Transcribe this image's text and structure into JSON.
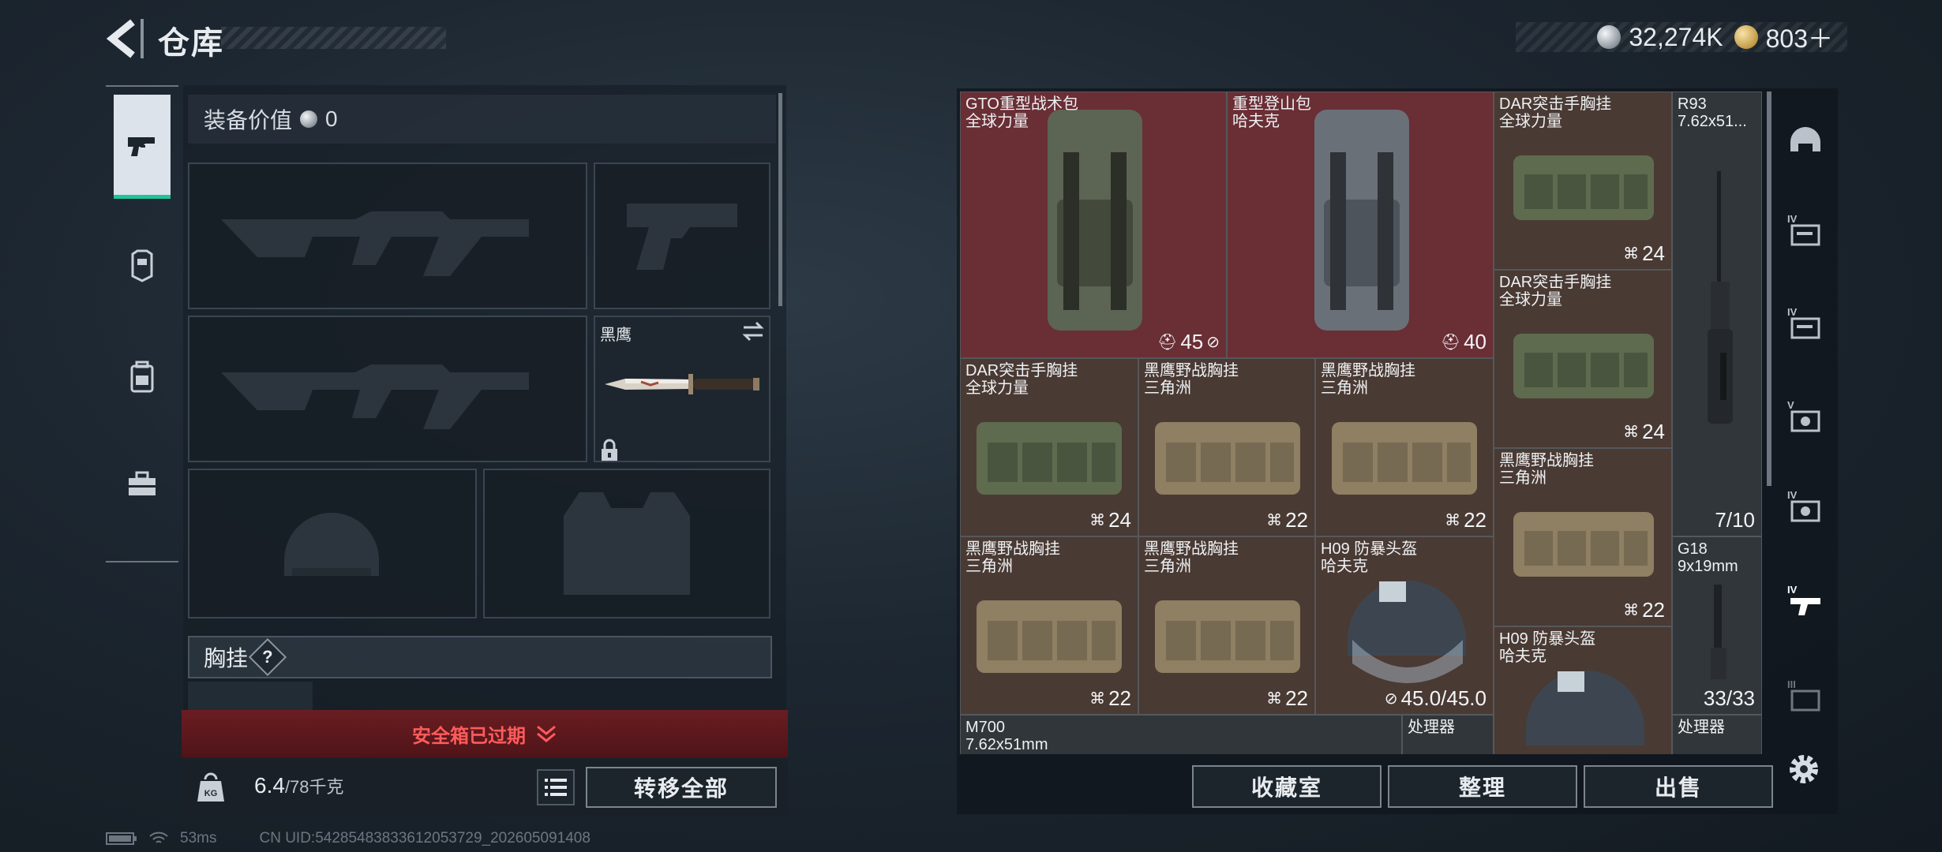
{
  "header": {
    "title": "仓库",
    "back_icon": "back-arrow-icon",
    "currency": [
      {
        "icon": "silver-coin-icon",
        "value": "32,274K"
      },
      {
        "icon": "gold-coin-icon",
        "value": "803＋"
      }
    ]
  },
  "rail": {
    "items": [
      {
        "icon": "pistol-icon",
        "active": true
      },
      {
        "icon": "armor-icon",
        "active": false
      },
      {
        "icon": "backpack-icon",
        "active": false
      },
      {
        "icon": "toolbox-icon",
        "active": false
      }
    ]
  },
  "equipment": {
    "value_label": "装备价值",
    "value_amount": "0",
    "melee_name": "黑鹰",
    "chest_label": "胸挂",
    "help_label": "?",
    "safe_box_label": "安全箱已过期",
    "weight_current": "6.4",
    "weight_max": "/78千克",
    "transfer_all_label": "转移全部"
  },
  "inventory": {
    "items": [
      {
        "name1": "GTO重型战术包",
        "name2": "全球力量",
        "count": "45",
        "count_icon": "slot-icon",
        "extra_icon": "no-insure-icon",
        "color": "red"
      },
      {
        "name1": "重型登山包",
        "name2": "哈夫克",
        "count": "40",
        "count_icon": "slot-icon",
        "color": "red"
      },
      {
        "name1": "DAR突击手胸挂",
        "name2": "全球力量",
        "count": "24",
        "count_icon": "vest-icon",
        "color": "brown"
      },
      {
        "name1": "R93",
        "name2": "7.62x51...",
        "count": "7/10",
        "color": "gray"
      },
      {
        "name1": "DAR突击手胸挂",
        "name2": "全球力量",
        "count": "24",
        "count_icon": "vest-icon",
        "color": "brown"
      },
      {
        "name1": "DAR突击手胸挂",
        "name2": "全球力量",
        "count": "24",
        "count_icon": "vest-icon",
        "color": "brown"
      },
      {
        "name1": "黑鹰野战胸挂",
        "name2": "三角洲",
        "count": "22",
        "count_icon": "vest-icon",
        "color": "brown"
      },
      {
        "name1": "黑鹰野战胸挂",
        "name2": "三角洲",
        "count": "22",
        "count_icon": "vest-icon",
        "color": "brown"
      },
      {
        "name1": "黑鹰野战胸挂",
        "name2": "三角洲",
        "count": "22",
        "count_icon": "vest-icon",
        "color": "brown"
      },
      {
        "name1": "黑鹰野战胸挂",
        "name2": "三角洲",
        "count": "22",
        "count_icon": "vest-icon",
        "color": "brown"
      },
      {
        "name1": "黑鹰野战胸挂",
        "name2": "三角洲",
        "count": "22",
        "count_icon": "vest-icon",
        "color": "brown"
      },
      {
        "name1": "H09 防暴头盔",
        "name2": "哈夫克",
        "count": "45.0/45.0",
        "extra_icon": "no-insure-icon",
        "color": "brown"
      },
      {
        "name1": "G18",
        "name2": "9x19mm",
        "count": "33/33",
        "color": "gray"
      },
      {
        "name1": "H09 防暴头盔",
        "name2": "哈夫克",
        "count": "",
        "color": "brown"
      },
      {
        "name1": "M700",
        "name2": "7.62x51mm",
        "count": "",
        "color": "gray"
      },
      {
        "name1": "处理器",
        "name2": "",
        "count": "",
        "color": "gray"
      },
      {
        "name1": "处理器",
        "name2": "",
        "count": "",
        "color": "gray"
      }
    ]
  },
  "filters": {
    "items": [
      {
        "icon": "helmet-filter-icon"
      },
      {
        "icon": "tier-iv-case-icon",
        "label": "IV"
      },
      {
        "icon": "tier-iv-case-icon",
        "label": "IV"
      },
      {
        "icon": "tier-v-ammo-icon",
        "label": "V"
      },
      {
        "icon": "tier-iv-ammo-icon",
        "label": "IV"
      },
      {
        "icon": "tier-iv-gun-icon",
        "label": "IV"
      },
      {
        "icon": "tier-iii-ammo-icon",
        "label": "III"
      }
    ],
    "settings_icon": "gear-icon"
  },
  "actions": {
    "collection_label": "收藏室",
    "sort_label": "整理",
    "sell_label": "出售"
  },
  "status": {
    "ping": "53ms",
    "uid": "CN UID:5428548383361205372​9_20260509140​8"
  },
  "colors": {
    "accent_green": "#21c49a",
    "alert_red": "#ff5b5b",
    "item_red": "#6a2e35",
    "item_brown": "#4a3a34"
  }
}
